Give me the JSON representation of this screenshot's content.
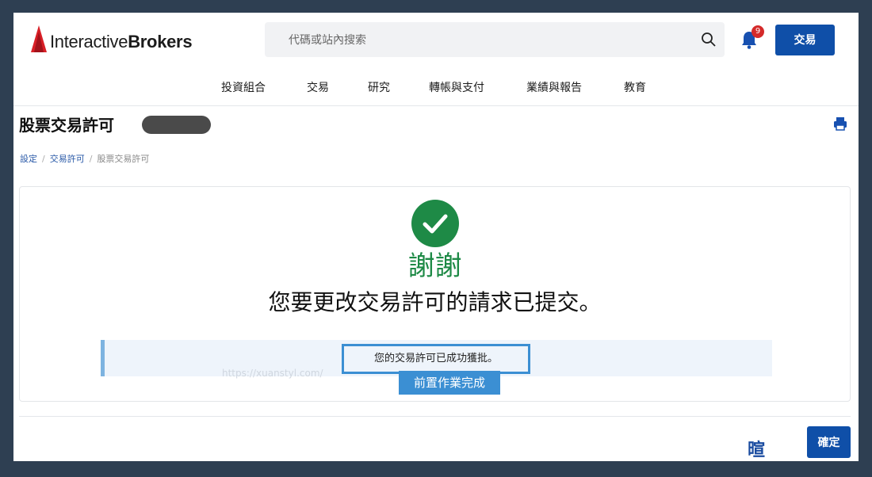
{
  "header": {
    "logo_text_regular": "Interactive",
    "logo_text_bold": "Brokers",
    "search_placeholder": "代碼或站內搜索",
    "notification_count": "9",
    "trade_button": "交易"
  },
  "nav": {
    "items": [
      "投資組合",
      "交易",
      "研究",
      "轉帳與支付",
      "業績與報告",
      "教育"
    ]
  },
  "page": {
    "title": "股票交易許可",
    "breadcrumb": [
      "設定",
      "交易許可",
      "股票交易許可"
    ]
  },
  "confirmation": {
    "thanks": "謝謝",
    "message": "您要更改交易許可的請求已提交。",
    "info_text": "您的交易許可已成功獲批。",
    "watermark": "https://xuanstyl.com/",
    "prereq_label": "前置作業完成"
  },
  "footer": {
    "glyph": "暄",
    "confirm_button": "確定"
  },
  "colors": {
    "brand_red": "#d81f26",
    "primary_blue": "#0f4fa8",
    "success_green": "#1e8a46",
    "info_blue": "#3b8fd3"
  }
}
